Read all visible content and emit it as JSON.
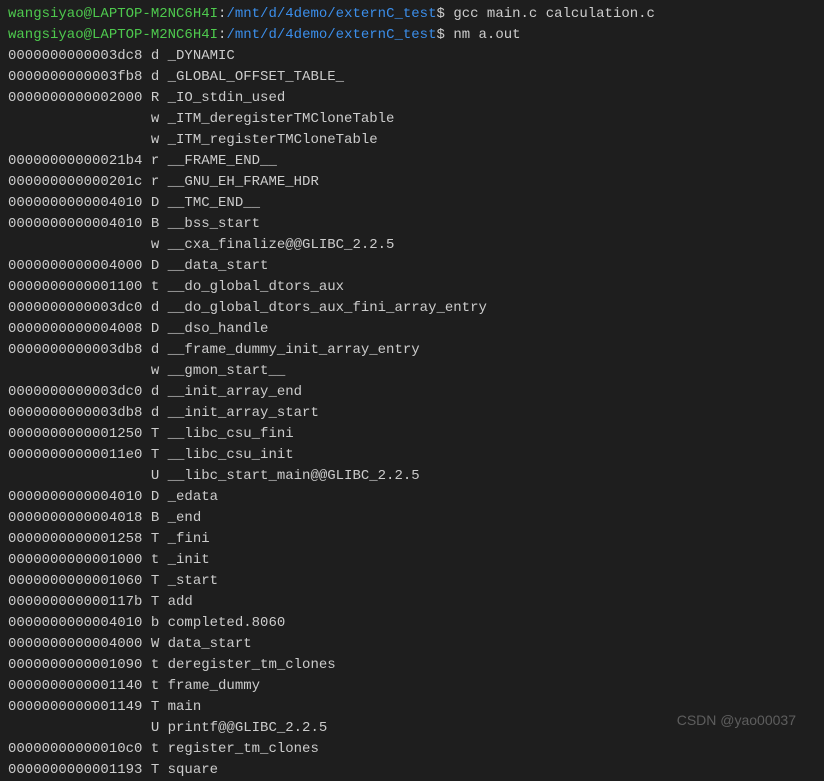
{
  "prompt": {
    "userHost": "wangsiyao@LAPTOP-M2NC6H4I",
    "path": "/mnt/d/4demo/externC_test",
    "dollar": "$"
  },
  "commands": [
    "gcc main.c calculation.c",
    "nm a.out"
  ],
  "output": [
    "0000000000003dc8 d _DYNAMIC",
    "0000000000003fb8 d _GLOBAL_OFFSET_TABLE_",
    "0000000000002000 R _IO_stdin_used",
    "                 w _ITM_deregisterTMCloneTable",
    "                 w _ITM_registerTMCloneTable",
    "00000000000021b4 r __FRAME_END__",
    "000000000000201c r __GNU_EH_FRAME_HDR",
    "0000000000004010 D __TMC_END__",
    "0000000000004010 B __bss_start",
    "                 w __cxa_finalize@@GLIBC_2.2.5",
    "0000000000004000 D __data_start",
    "0000000000001100 t __do_global_dtors_aux",
    "0000000000003dc0 d __do_global_dtors_aux_fini_array_entry",
    "0000000000004008 D __dso_handle",
    "0000000000003db8 d __frame_dummy_init_array_entry",
    "                 w __gmon_start__",
    "0000000000003dc0 d __init_array_end",
    "0000000000003db8 d __init_array_start",
    "0000000000001250 T __libc_csu_fini",
    "00000000000011e0 T __libc_csu_init",
    "                 U __libc_start_main@@GLIBC_2.2.5",
    "0000000000004010 D _edata",
    "0000000000004018 B _end",
    "0000000000001258 T _fini",
    "0000000000001000 t _init",
    "0000000000001060 T _start",
    "000000000000117b T add",
    "0000000000004010 b completed.8060",
    "0000000000004000 W data_start",
    "0000000000001090 t deregister_tm_clones",
    "0000000000001140 t frame_dummy",
    "0000000000001149 T main",
    "                 U printf@@GLIBC_2.2.5",
    "00000000000010c0 t register_tm_clones",
    "0000000000001193 T square"
  ],
  "watermark": "CSDN @yao00037"
}
